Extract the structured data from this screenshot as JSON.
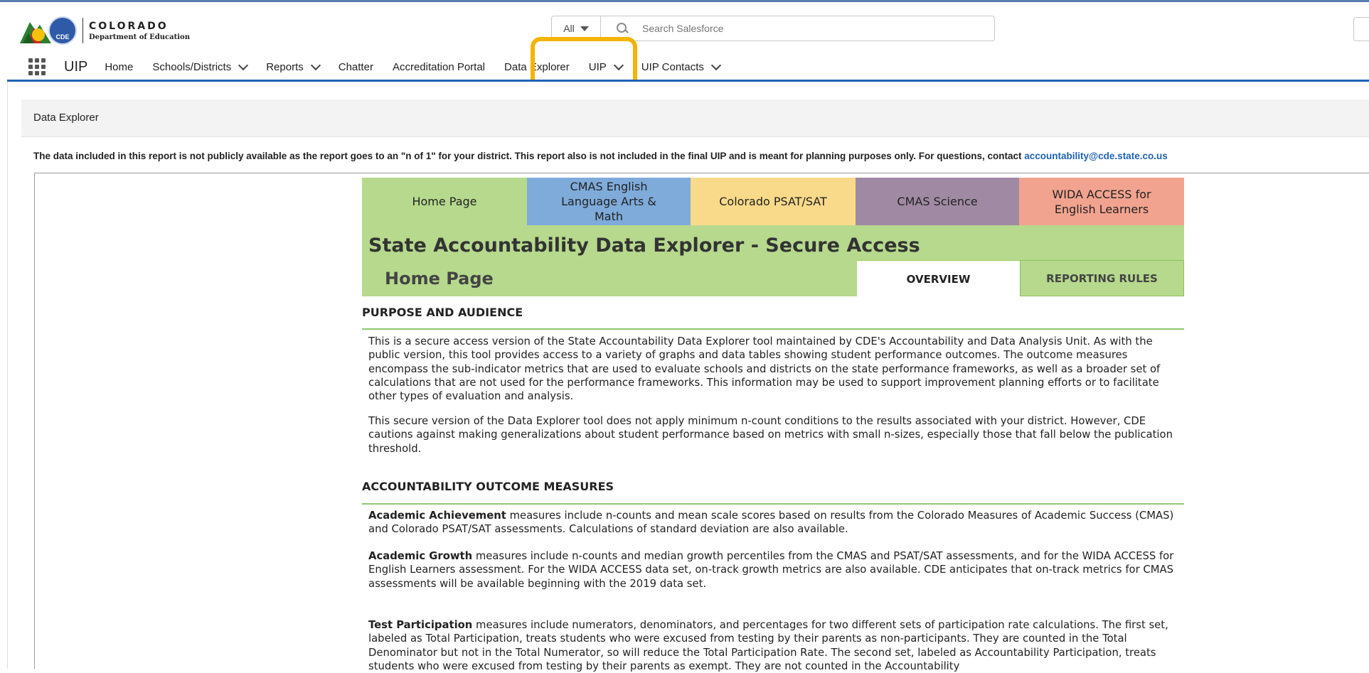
{
  "header": {
    "logo_line1": "COLORADO",
    "logo_line2": "Department of Education",
    "logo_badge": "CDE",
    "search_scope": "All",
    "search_placeholder": "Search Salesforce"
  },
  "nav": {
    "app_name": "UIP",
    "items": [
      {
        "label": "Home"
      },
      {
        "label": "Schools/Districts"
      },
      {
        "label": "Reports"
      },
      {
        "label": "Chatter"
      },
      {
        "label": "Accreditation Portal"
      },
      {
        "label": "Data Explorer"
      },
      {
        "label": "UIP"
      },
      {
        "label": "UIP Contacts"
      }
    ]
  },
  "page": {
    "title": "Data Explorer",
    "notice": "The data included in this report is not publicly available as the report goes to an \"n of 1\" for your district. This report also is not included in the final UIP and is meant for planning purposes only. For questions, contact ",
    "notice_link": "accountability@cde.state.co.us"
  },
  "dashboard": {
    "tabs": [
      {
        "label": "Home Page"
      },
      {
        "label": "CMAS English Language Arts & Math"
      },
      {
        "label": "Colorado PSAT/SAT"
      },
      {
        "label": "CMAS Science"
      },
      {
        "label": "WIDA ACCESS for English Learners"
      }
    ],
    "title": "State Accountability Data Explorer - Secure Access",
    "subtitle": "Home Page",
    "subtabs": {
      "overview": "OVERVIEW",
      "rules": "REPORTING RULES"
    },
    "section1": {
      "heading": "PURPOSE AND AUDIENCE",
      "p1": "This is a secure access version of the State Accountability Data Explorer tool maintained by CDE's Accountability and Data Analysis Unit. As with the public version, this tool provides access to a variety of graphs and data tables showing student performance outcomes. The outcome measures encompass the sub-indicator metrics that are used to evaluate schools and districts on the state performance frameworks, as well as a broader set of calculations that are not used for the performance frameworks. This information may be used to support improvement planning efforts or to facilitate other types of evaluation and analysis.",
      "p2": "This secure version of the Data Explorer tool does not apply minimum n-count conditions to the results associated with your district. However, CDE cautions against making generalizations about student performance based on metrics with small n-sizes, especially those that fall below the publication threshold."
    },
    "section2": {
      "heading": "ACCOUNTABILITY OUTCOME MEASURES",
      "achievement_term": "Academic Achievement",
      "achievement_text": " measures include n-counts and mean scale scores based on results from the Colorado Measures of Academic Success (CMAS) and Colorado PSAT/SAT assessments. Calculations of standard deviation are also available.",
      "growth_term": "Academic Growth",
      "growth_text": " measures include n-counts and median growth percentiles from the CMAS and PSAT/SAT assessments, and for the WIDA ACCESS for English Learners assessment. For the WIDA ACCESS data set, on-track growth metrics are also available. CDE anticipates that on-track metrics for CMAS assessments will be available beginning with the 2019 data set.",
      "participation_term": "Test Participation",
      "participation_text": " measures include numerators, denominators, and percentages for two different sets of participation rate calculations. The first set, labeled as Total Participation, treats students who were excused from testing by their parents as non-participants. They are counted in the Total Denominator but not in the Total Numerator, so will reduce the Total Participation Rate. The second set, labeled as Accountability Participation, treats students who were excused from testing by their parents as exempt. They are not counted in the Accountability"
    }
  }
}
